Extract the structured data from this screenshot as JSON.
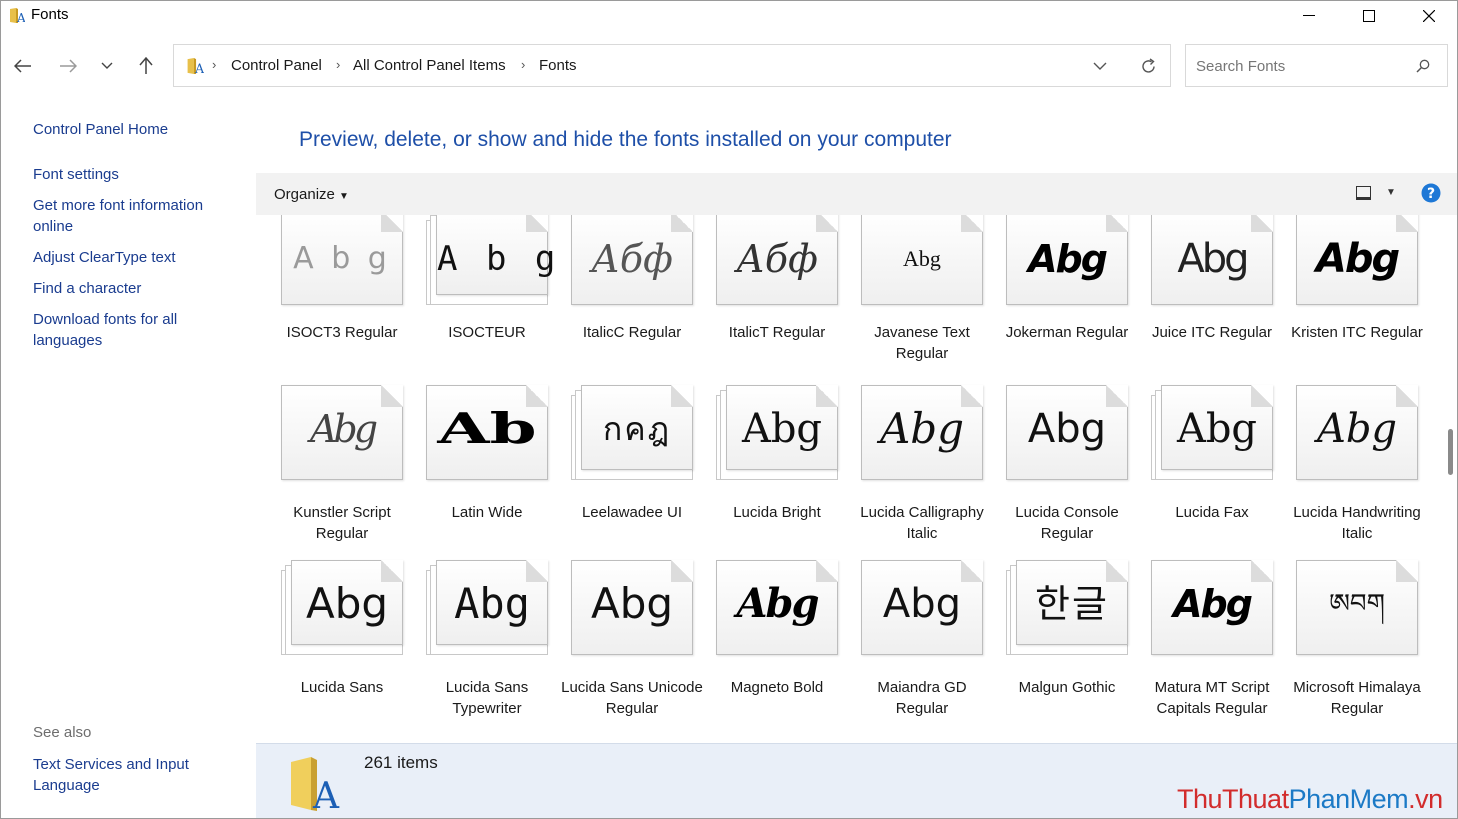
{
  "window": {
    "title": "Fonts"
  },
  "address": {
    "crumbs": [
      "Control Panel",
      "All Control Panel Items",
      "Fonts"
    ]
  },
  "search": {
    "placeholder": "Search Fonts"
  },
  "left_pane": {
    "links": [
      "Control Panel Home",
      "Font settings",
      "Get more font information online",
      "Adjust ClearType text",
      "Find a character",
      "Download fonts for all languages"
    ],
    "see_also_label": "See also",
    "see_also_links": [
      "Text Services and Input Language"
    ]
  },
  "main": {
    "heading": "Preview, delete, or show and hide the fonts installed on your computer",
    "organize_label": "Organize",
    "fonts": [
      {
        "name": "ISOCT3 Regular",
        "preview": "A b g",
        "stack": false
      },
      {
        "name": "ISOCTEUR",
        "preview": "A b g",
        "stack": true
      },
      {
        "name": "ItalicC Regular",
        "preview": "Абф",
        "stack": false
      },
      {
        "name": "ItalicT Regular",
        "preview": "Абф",
        "stack": false
      },
      {
        "name": "Javanese Text Regular",
        "preview": "Abg",
        "stack": false
      },
      {
        "name": "Jokerman Regular",
        "preview": "Abg",
        "stack": false
      },
      {
        "name": "Juice ITC Regular",
        "preview": "Abg",
        "stack": false
      },
      {
        "name": "Kristen ITC Regular",
        "preview": "Abg",
        "stack": false
      },
      {
        "name": "Kunstler Script Regular",
        "preview": "Abg",
        "stack": false
      },
      {
        "name": "Latin Wide",
        "preview": "Ab",
        "stack": false
      },
      {
        "name": "Leelawadee UI",
        "preview": "กคฎ",
        "stack": true
      },
      {
        "name": "Lucida Bright",
        "preview": "Abg",
        "stack": true
      },
      {
        "name": "Lucida Calligraphy Italic",
        "preview": "Abg",
        "stack": false
      },
      {
        "name": "Lucida Console Regular",
        "preview": "Abg",
        "stack": false
      },
      {
        "name": "Lucida Fax",
        "preview": "Abg",
        "stack": true
      },
      {
        "name": "Lucida Handwriting Italic",
        "preview": "Abg",
        "stack": false
      },
      {
        "name": "Lucida Sans",
        "preview": "Abg",
        "stack": true
      },
      {
        "name": "Lucida Sans Typewriter",
        "preview": "Abg",
        "stack": true
      },
      {
        "name": "Lucida Sans Unicode Regular",
        "preview": "Abg",
        "stack": false
      },
      {
        "name": "Magneto Bold",
        "preview": "Abg",
        "stack": false
      },
      {
        "name": "Maiandra GD Regular",
        "preview": "Abg",
        "stack": false
      },
      {
        "name": "Malgun Gothic",
        "preview": "한글",
        "stack": true
      },
      {
        "name": "Matura MT Script Capitals Regular",
        "preview": "Abg",
        "stack": false
      },
      {
        "name": "Microsoft Himalaya Regular",
        "preview": "ཨབག",
        "stack": false
      }
    ]
  },
  "status": {
    "item_count": "261 items"
  },
  "watermark": {
    "part1": "ThuThuat",
    "part2": "PhanMem",
    "part3": ".vn"
  }
}
